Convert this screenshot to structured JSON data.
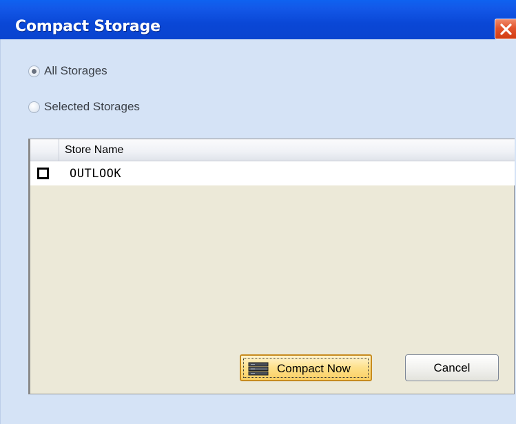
{
  "window": {
    "title": "Compact Storage"
  },
  "options": {
    "all_storages_label": "All Storages",
    "all_storages_checked": true,
    "selected_storages_label": "Selected Storages",
    "selected_storages_checked": false
  },
  "grid": {
    "columns": [
      "",
      "Store Name"
    ],
    "rows": [
      {
        "checked": false,
        "store_name": "OUTLOOK"
      }
    ]
  },
  "buttons": {
    "compact_now_label": "Compact Now",
    "cancel_label": "Cancel"
  },
  "colors": {
    "titlebar": "#0a47d6",
    "client_bg": "#d5e3f6",
    "grid_bg": "#ece9d8",
    "default_button": "#fde08a"
  }
}
